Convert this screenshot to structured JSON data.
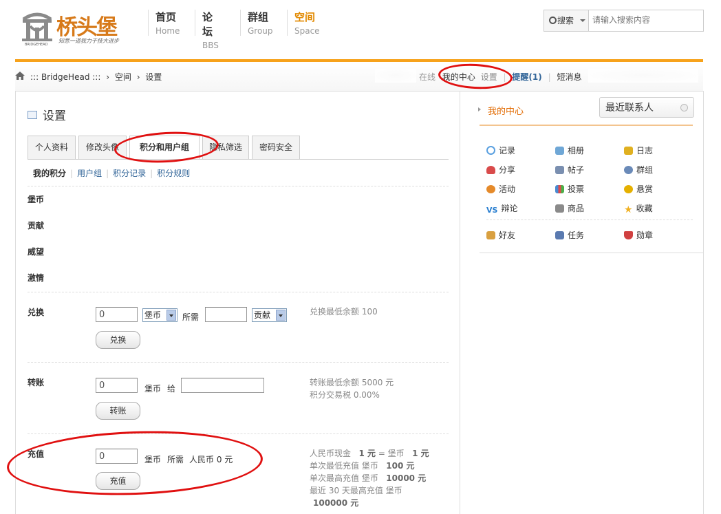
{
  "logo": {
    "text": "桥头堡",
    "slogan": "知悉一道我力于技大进步",
    "mini": "BRIDGEHEAD"
  },
  "nav": [
    {
      "cn": "首页",
      "en": "Home"
    },
    {
      "cn": "论坛",
      "en": "BBS"
    },
    {
      "cn": "群组",
      "en": "Group"
    },
    {
      "cn": "空间",
      "en": "Space"
    }
  ],
  "search": {
    "button": "搜索",
    "placeholder": "请输入搜索内容"
  },
  "breadcrumb": {
    "site": "::: BridgeHead :::",
    "sep1": "›",
    "space": "空间",
    "sep2": "›",
    "page": "设置"
  },
  "userbar": {
    "online": "在线",
    "center": "我的中心",
    "settings": "设置",
    "remind": "提醒(1)",
    "messages": "短消息",
    "sep": "|"
  },
  "page": {
    "title": "设置"
  },
  "tabs": [
    "个人资料",
    "修改头像",
    "积分和用户组",
    "隐私筛选",
    "密码安全"
  ],
  "subtabs": [
    "我的积分",
    "用户组",
    "积分记录",
    "积分规则"
  ],
  "credits": [
    "堡币",
    "贡献",
    "威望",
    "激情"
  ],
  "exchange": {
    "label": "兑换",
    "value": "0",
    "from_unit": "堡币",
    "need": "所需",
    "to_value": "",
    "to_unit": "贡献",
    "info": "兑换最低余额",
    "info_value": "100",
    "button": "兑换"
  },
  "transfer": {
    "label": "转账",
    "value": "0",
    "unit": "堡币",
    "to": "给",
    "to_value": "",
    "info1": "转账最低余额 5000 元",
    "info2": "积分交易税 0.00%",
    "button": "转账"
  },
  "recharge": {
    "label": "充值",
    "value": "0",
    "unit": "堡币",
    "need": "所需",
    "rmb": "人民币 0 元",
    "button": "充值",
    "info": [
      {
        "text": "人民币现金",
        "v1": "1 元",
        "mid": "= 堡币",
        "v2": "1 元"
      },
      {
        "text": "单次最低充值 堡币",
        "v1": "100 元"
      },
      {
        "text": "单次最高充值 堡币",
        "v1": "10000 元"
      },
      {
        "text": "最近 30 天最高充值 堡币",
        "v1": ""
      },
      {
        "text": "",
        "v1": "100000 元"
      }
    ]
  },
  "sidebar": {
    "header": "我的中心",
    "recent": "最近联系人",
    "apps": [
      {
        "label": "记录",
        "icon": "speech-bubble-icon",
        "color": "#5aa0e0"
      },
      {
        "label": "相册",
        "icon": "photo-album-icon",
        "color": "#6fa7d6"
      },
      {
        "label": "日志",
        "icon": "journal-icon",
        "color": "#e0b020"
      },
      {
        "label": "分享",
        "icon": "heart-share-icon",
        "color": "#d94b4b"
      },
      {
        "label": "帖子",
        "icon": "post-pin-icon",
        "color": "#7a8fb0"
      },
      {
        "label": "群组",
        "icon": "group-icon",
        "color": "#6a8ab8"
      },
      {
        "label": "活动",
        "icon": "activity-icon",
        "color": "#e58a2a"
      },
      {
        "label": "投票",
        "icon": "vote-chart-icon",
        "color": "#4a8ad0"
      },
      {
        "label": "悬赏",
        "icon": "reward-gold-icon",
        "color": "#e5b000"
      },
      {
        "label": "辩论",
        "icon": "vs-debate-icon",
        "color": "#2a7fd0"
      },
      {
        "label": "商品",
        "icon": "shopping-cart-icon",
        "color": "#8a8a8a"
      },
      {
        "label": "收藏",
        "icon": "star-icon",
        "color": "#f0b020"
      },
      {
        "label": "好友",
        "icon": "handshake-icon",
        "color": "#d9a040"
      },
      {
        "label": "任务",
        "icon": "task-icon",
        "color": "#5a7ab0"
      },
      {
        "label": "勋章",
        "icon": "medal-icon",
        "color": "#d04040"
      }
    ]
  }
}
